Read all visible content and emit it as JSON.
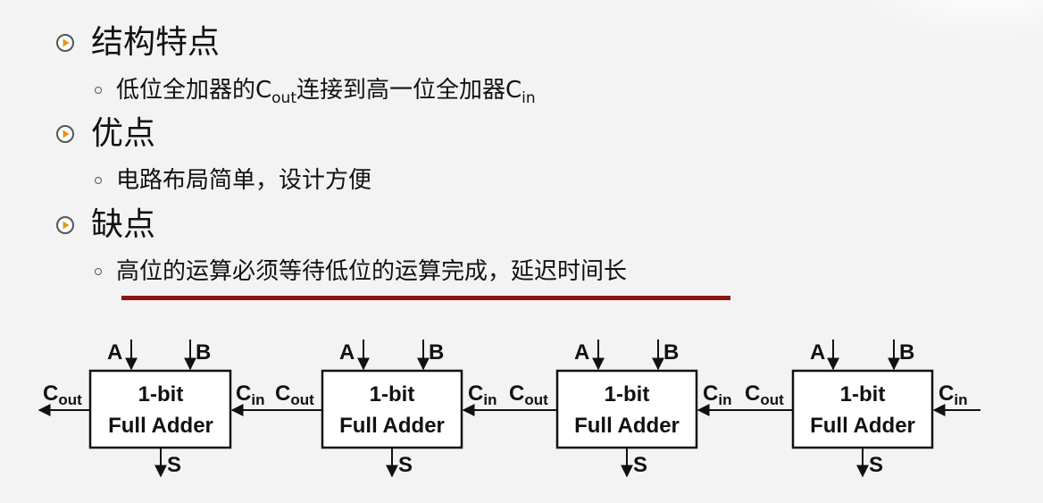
{
  "sections": [
    {
      "heading": "结构特点",
      "bullet": {
        "prefix": "低位全加器的C",
        "sub1": "out",
        "middle": "连接到高一位全加器C",
        "sub2": "in"
      }
    },
    {
      "heading": "优点",
      "bullet": {
        "text": "电路布局简单，设计方便"
      }
    },
    {
      "heading": "缺点",
      "bullet": {
        "text": "高位的运算必须等待低位的运算完成，延迟时间长"
      }
    }
  ],
  "icons": {
    "section_bullet": "play-circle-icon",
    "sub_bullet": "hollow-dot-icon"
  },
  "colors": {
    "background": "#f3f3f3",
    "bullet_orange": "#e8941c",
    "underline": "#8b1414"
  },
  "diagram": {
    "adder_line1": "1-bit",
    "adder_line2": "Full Adder",
    "input_a": "A",
    "input_b": "B",
    "output_s": "S",
    "carry_label": "C",
    "carry_out_sub": "out",
    "carry_in_sub": "in",
    "adder_count": 4
  }
}
